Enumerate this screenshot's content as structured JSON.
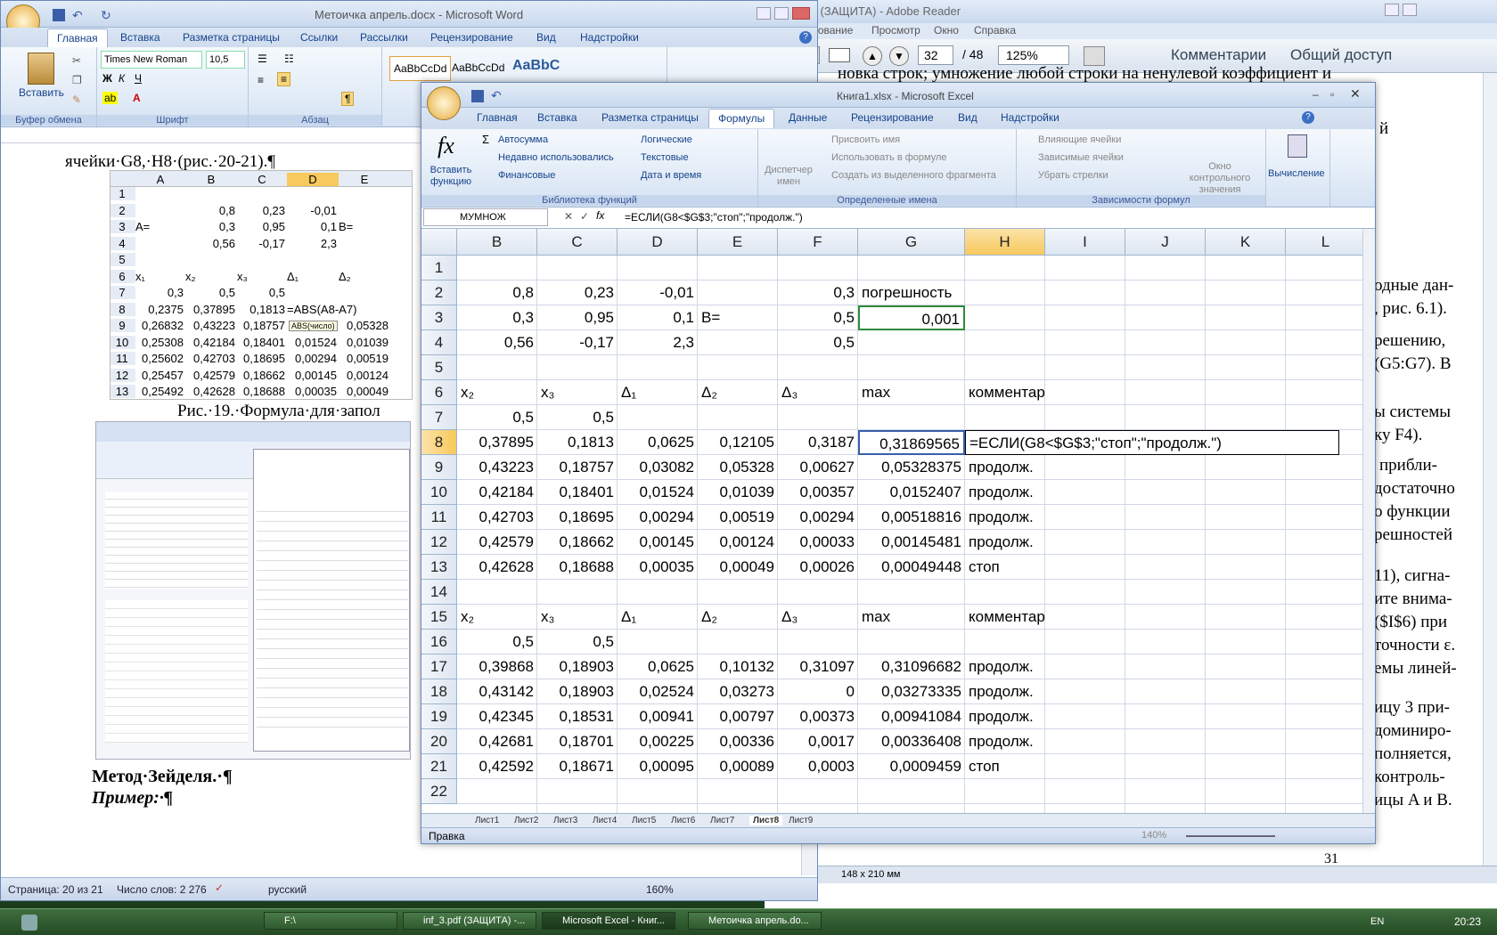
{
  "word": {
    "title": "Метоичка апрель.docx - Microsoft Word",
    "tabs": [
      "Главная",
      "Вставка",
      "Разметка страницы",
      "Ссылки",
      "Рассылки",
      "Рецензирование",
      "Вид",
      "Надстройки"
    ],
    "font_name": "Times New Roman",
    "font_size": "10,5",
    "groups": {
      "clipboard": "Буфер обмена",
      "font": "Шрифт",
      "paragraph": "Абзац"
    },
    "paste": "Вставить",
    "styles": [
      "AaBbCcDd",
      "AaBbCcDd",
      "AaBbC"
    ],
    "doc_line1": "ячейки·G8,·H8·(рис.·20-21).¶",
    "caption19": "Рис.·19.·Формула·для·запол",
    "method": "Метод·Зейделя.·¶",
    "example": "Пример:·¶",
    "inner_table": {
      "cols": [
        "A",
        "B",
        "C",
        "D",
        "E"
      ],
      "rows": [
        [
          "1",
          "",
          "",
          "",
          "",
          ""
        ],
        [
          "2",
          "",
          "0,8",
          "0,23",
          "-0,01",
          ""
        ],
        [
          "3",
          "A=",
          "0,3",
          "0,95",
          "0,1",
          "B="
        ],
        [
          "4",
          "",
          "0,56",
          "-0,17",
          "2,3",
          ""
        ],
        [
          "5",
          "",
          "",
          "",
          "",
          ""
        ],
        [
          "6",
          "x₁",
          "x₂",
          "x₃",
          "Δ₁",
          "Δ₂"
        ],
        [
          "7",
          "0,3",
          "0,5",
          "0,5",
          "",
          ""
        ],
        [
          "8",
          "0,2375",
          "0,37895",
          "0,1813",
          "=ABS(A8-A7)",
          ""
        ],
        [
          "9",
          "0,26832",
          "0,43223",
          "0,18757",
          "0,05",
          "0,05328"
        ],
        [
          "10",
          "0,25308",
          "0,42184",
          "0,18401",
          "0,01524",
          "0,01039"
        ],
        [
          "11",
          "0,25602",
          "0,42703",
          "0,18695",
          "0,00294",
          "0,00519"
        ],
        [
          "12",
          "0,25457",
          "0,42579",
          "0,18662",
          "0,00145",
          "0,00124"
        ],
        [
          "13",
          "0,25492",
          "0,42628",
          "0,18688",
          "0,00035",
          "0,00049"
        ]
      ],
      "tooltip": "ABS(число)"
    },
    "status": {
      "page": "Страница: 20 из 21",
      "words": "Число слов: 2 276",
      "lang": "русский",
      "zoom": "160%"
    }
  },
  "reader": {
    "title": "3.pdf (ЗАЩИТА) - Adobe Reader",
    "menu": [
      "Редактирование",
      "Просмотр",
      "Окно",
      "Справка"
    ],
    "page": "32",
    "pages": "/ 48",
    "zoom": "125%",
    "comments": "Комментарии",
    "share": "Общий доступ",
    "lines": [
      "новка строк; умножение любой строки на ненулевой коэффициент и",
      "й",
      "одные дан-",
      ", рис. 6.1).",
      "решению,",
      "(G5:G7). В",
      "ы системы",
      "ку F4).",
      "прибли-",
      "достаточно",
      "о функции",
      "решностей",
      "11), сигна-",
      "ите внима-",
      "($I$6) при",
      "точности ε.",
      "емы линей-",
      "ицу 3 при-",
      "доминиро-",
      "полняется,",
      "контроль-",
      "ицы A и B."
    ],
    "page_num": "31",
    "size": "148 x 210 мм"
  },
  "excel": {
    "title": "Книга1.xlsx - Microsoft Excel",
    "tabs": [
      "Главная",
      "Вставка",
      "Разметка страницы",
      "Формулы",
      "Данные",
      "Рецензирование",
      "Вид",
      "Надстройки"
    ],
    "active_tab": "Формулы",
    "ribbon": {
      "insert_fn": "Вставить функцию",
      "autosum": "Автосумма",
      "recent": "Недавно использовались",
      "financial": "Финансовые",
      "logical": "Логические",
      "text": "Текстовые",
      "datetime": "Дата и время",
      "lib_label": "Библиотека функций",
      "name_mgr": "Диспетчер имен",
      "assign": "Присвоить имя",
      "use": "Использовать в формуле",
      "create": "Создать из выделенного фрагмента",
      "names_label": "Определенные имена",
      "precedents": "Влияющие ячейки",
      "dependents": "Зависимые ячейки",
      "remove": "Убрать стрелки",
      "watch": "Окно контрольного значения",
      "audit_label": "Зависимости формул",
      "calc": "Вычисление"
    },
    "namebox": "МУМНОЖ",
    "formula": "=ЕСЛИ(G8<$G$3;\"стоп\";\"продолж.\")",
    "cols": [
      "B",
      "C",
      "D",
      "E",
      "F",
      "G",
      "H",
      "I",
      "J",
      "K",
      "L"
    ],
    "rows": [
      {
        "n": "1",
        "c": [
          "",
          "",
          "",
          "",
          "",
          "",
          "",
          "",
          ""
        ]
      },
      {
        "n": "2",
        "c": [
          "0,8",
          "0,23",
          "-0,01",
          "",
          "0,3",
          "погрешность",
          ""
        ]
      },
      {
        "n": "3",
        "c": [
          "0,3",
          "0,95",
          "0,1",
          "B=",
          "0,5",
          "0,001",
          ""
        ]
      },
      {
        "n": "4",
        "c": [
          "0,56",
          "-0,17",
          "2,3",
          "",
          "0,5",
          "",
          ""
        ]
      },
      {
        "n": "5",
        "c": [
          "",
          "",
          "",
          "",
          "",
          "",
          ""
        ]
      },
      {
        "n": "6",
        "c": [
          "x₂",
          "x₃",
          "Δ₁",
          "Δ₂",
          "Δ₃",
          "max",
          "комментарии"
        ]
      },
      {
        "n": "7",
        "c": [
          "0,5",
          "0,5",
          "",
          "",
          "",
          "",
          ""
        ]
      },
      {
        "n": "8",
        "c": [
          "0,37895",
          "0,1813",
          "0,0625",
          "0,12105",
          "0,3187",
          "0,31869565",
          "=ЕСЛИ(G8<$G$3;\"стоп\";\"продолж.\")"
        ]
      },
      {
        "n": "9",
        "c": [
          "0,43223",
          "0,18757",
          "0,03082",
          "0,05328",
          "0,00627",
          "0,05328375",
          "продолж."
        ]
      },
      {
        "n": "10",
        "c": [
          "0,42184",
          "0,18401",
          "0,01524",
          "0,01039",
          "0,00357",
          "0,0152407",
          "продолж."
        ]
      },
      {
        "n": "11",
        "c": [
          "0,42703",
          "0,18695",
          "0,00294",
          "0,00519",
          "0,00294",
          "0,00518816",
          "продолж."
        ]
      },
      {
        "n": "12",
        "c": [
          "0,42579",
          "0,18662",
          "0,00145",
          "0,00124",
          "0,00033",
          "0,00145481",
          "продолж."
        ]
      },
      {
        "n": "13",
        "c": [
          "0,42628",
          "0,18688",
          "0,00035",
          "0,00049",
          "0,00026",
          "0,00049448",
          "стоп"
        ]
      },
      {
        "n": "14",
        "c": [
          "",
          "",
          "",
          "",
          "",
          "",
          ""
        ]
      },
      {
        "n": "15",
        "c": [
          "x₂",
          "x₃",
          "Δ₁",
          "Δ₂",
          "Δ₃",
          "max",
          "комментарии"
        ]
      },
      {
        "n": "16",
        "c": [
          "0,5",
          "0,5",
          "",
          "",
          "",
          "",
          ""
        ]
      },
      {
        "n": "17",
        "c": [
          "0,39868",
          "0,18903",
          "0,0625",
          "0,10132",
          "0,31097",
          "0,31096682",
          "продолж."
        ]
      },
      {
        "n": "18",
        "c": [
          "0,43142",
          "0,18903",
          "0,02524",
          "0,03273",
          "0",
          "0,03273335",
          "продолж."
        ]
      },
      {
        "n": "19",
        "c": [
          "0,42345",
          "0,18531",
          "0,00941",
          "0,00797",
          "0,00373",
          "0,00941084",
          "продолж."
        ]
      },
      {
        "n": "20",
        "c": [
          "0,42681",
          "0,18701",
          "0,00225",
          "0,00336",
          "0,0017",
          "0,00336408",
          "продолж."
        ]
      },
      {
        "n": "21",
        "c": [
          "0,42592",
          "0,18671",
          "0,00095",
          "0,00089",
          "0,0003",
          "0,0009459",
          "стоп"
        ]
      },
      {
        "n": "22",
        "c": [
          "",
          "",
          "",
          "",
          "",
          "",
          ""
        ]
      }
    ],
    "sheets": [
      "Лист1",
      "Лист2",
      "Лист3",
      "Лист4",
      "Лист5",
      "Лист6",
      "Лист7",
      "Лист8",
      "Лист9"
    ],
    "active_sheet": "Лист8",
    "mode": "Правка",
    "zoom": "140%"
  },
  "taskbar": {
    "items": [
      "F:\\",
      "inf_3.pdf (ЗАЩИТА) -...",
      "Microsoft Excel - Книг...",
      "Метоичка апрель.do..."
    ],
    "lang": "EN",
    "clock": "20:23"
  }
}
